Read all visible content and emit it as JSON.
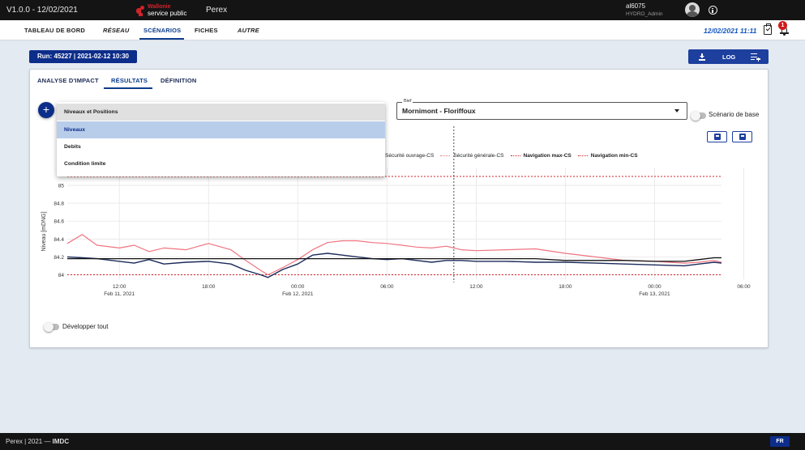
{
  "topbar": {
    "version": "V1.0.0 - 12/02/2021",
    "logo_line1": "Wallonie",
    "logo_line2": "service public",
    "app_name": "Perex",
    "user_name": "al6075",
    "user_role": "HYDRO_Admin"
  },
  "nav": {
    "items": [
      "TABLEAU DE BORD",
      "RÉSEAU",
      "SCÉNARIOS",
      "FICHES",
      "AUTRE"
    ],
    "active": "SCÉNARIOS",
    "datetime": "12/02/2021 11:11",
    "notification_count": "1"
  },
  "run": {
    "label": "Run: 45227 | 2021-02-12 10:30",
    "log_label": "LOG"
  },
  "tabs": {
    "items": [
      "ANALYSE D'IMPACT",
      "RÉSULTATS",
      "DÉFINITION"
    ],
    "active": "RÉSULTATS"
  },
  "dropdown": {
    "header": "Niveaux et Positions",
    "options": [
      "Niveaux",
      "Debits",
      "Condition limite"
    ],
    "selected": "Niveaux"
  },
  "bief": {
    "label": "Bief",
    "value": "Mornimont - Floriffoux"
  },
  "toggles": {
    "scenario_base": "Scénario de base",
    "developper_tout": "Développer tout"
  },
  "footer": {
    "text_prefix": "Perex | 2021 — ",
    "text_brand": "IMDC",
    "lang": "FR"
  },
  "colors": {
    "brand_blue": "#0d2d8a",
    "accent_blue": "#1455c0",
    "red": "#d2232a",
    "series_pink": "#f07480",
    "series_navy": "#1b2a5a"
  },
  "chart_data": {
    "type": "line",
    "ylabel": "Niveau [mDNG]",
    "ylim": [
      83.95,
      85.2
    ],
    "yticks": [
      "84",
      "84.2",
      "84.4",
      "84.6",
      "84.8",
      "85"
    ],
    "xticks": [
      {
        "label": "12:00",
        "date": "Feb 11, 2021"
      },
      {
        "label": "18:00",
        "date": ""
      },
      {
        "label": "00:00",
        "date": "Feb 12, 2021"
      },
      {
        "label": "06:00",
        "date": ""
      },
      {
        "label": "12:00",
        "date": ""
      },
      {
        "label": "18:00",
        "date": ""
      },
      {
        "label": "00:00",
        "date": "Feb 13, 2021"
      },
      {
        "label": "06:00",
        "date": ""
      }
    ],
    "legend": [
      {
        "name": "Sécurité ouvrage-CS",
        "color": "#c0c0c0"
      },
      {
        "name": "Sécurité générale-CS",
        "color": "#f07480"
      },
      {
        "name": "Navigation max-CS",
        "color": "#d2232a"
      },
      {
        "name": "Navigation min-CS",
        "color": "#d2232a"
      }
    ],
    "x_hours_start": 8.5,
    "x_hours_end": 52.5,
    "current_time_hours": 34.5,
    "reference_lines": [
      {
        "name": "Navigation max-CS",
        "value": 85.1,
        "color": "#d2232a"
      },
      {
        "name": "Navigation min-CS",
        "value": 84.0,
        "color": "#d2232a"
      }
    ],
    "series": [
      {
        "color": "#f07480",
        "x": [
          8.5,
          9.5,
          10.5,
          12,
          13,
          14,
          15,
          16.5,
          18,
          19.5,
          20.5,
          21.5,
          22,
          23,
          24,
          25,
          26,
          27,
          28,
          29,
          30,
          31,
          32,
          33,
          34,
          35,
          36,
          38,
          40,
          42,
          44,
          46,
          48,
          50,
          51,
          52,
          52.5
        ],
        "y": [
          84.35,
          84.45,
          84.33,
          84.3,
          84.33,
          84.26,
          84.3,
          84.28,
          84.35,
          84.28,
          84.16,
          84.05,
          84.0,
          84.08,
          84.17,
          84.28,
          84.36,
          84.38,
          84.38,
          84.36,
          84.35,
          84.33,
          84.31,
          84.3,
          84.32,
          84.28,
          84.27,
          84.28,
          84.29,
          84.24,
          84.2,
          84.16,
          84.15,
          84.13,
          84.14,
          84.16,
          84.14
        ]
      },
      {
        "color": "#1b2a5a",
        "x": [
          8.5,
          9.5,
          10.5,
          12,
          13,
          14,
          15,
          16.5,
          18,
          19.5,
          20.5,
          21.5,
          22,
          23,
          24,
          25,
          26,
          27,
          28,
          29,
          30,
          31,
          32,
          33,
          34,
          35,
          36,
          38,
          40,
          42,
          44,
          46,
          48,
          50,
          51,
          52,
          52.5
        ],
        "y": [
          84.2,
          84.19,
          84.18,
          84.15,
          84.13,
          84.17,
          84.12,
          84.14,
          84.15,
          84.12,
          84.05,
          84.0,
          83.97,
          84.06,
          84.12,
          84.22,
          84.24,
          84.22,
          84.2,
          84.18,
          84.17,
          84.18,
          84.16,
          84.14,
          84.16,
          84.16,
          84.15,
          84.15,
          84.14,
          84.14,
          84.13,
          84.12,
          84.11,
          84.1,
          84.12,
          84.14,
          84.13
        ]
      },
      {
        "color": "#111111",
        "x": [
          8.5,
          9.5,
          10.5,
          12,
          13,
          14,
          15,
          16.5,
          18,
          19.5,
          20.5,
          21.5,
          22,
          23,
          24,
          25,
          26,
          27,
          28,
          29,
          30,
          31,
          32,
          33,
          34,
          35,
          36,
          38,
          40,
          42,
          44,
          46,
          48,
          50,
          51,
          52,
          52.5
        ],
        "y": [
          84.18,
          84.18,
          84.18,
          84.18,
          84.18,
          84.18,
          84.18,
          84.18,
          84.18,
          84.18,
          84.18,
          84.18,
          84.18,
          84.18,
          84.18,
          84.18,
          84.18,
          84.18,
          84.18,
          84.18,
          84.18,
          84.18,
          84.18,
          84.18,
          84.18,
          84.18,
          84.18,
          84.18,
          84.18,
          84.16,
          84.16,
          84.16,
          84.15,
          84.15,
          84.17,
          84.19,
          84.19
        ]
      }
    ]
  }
}
